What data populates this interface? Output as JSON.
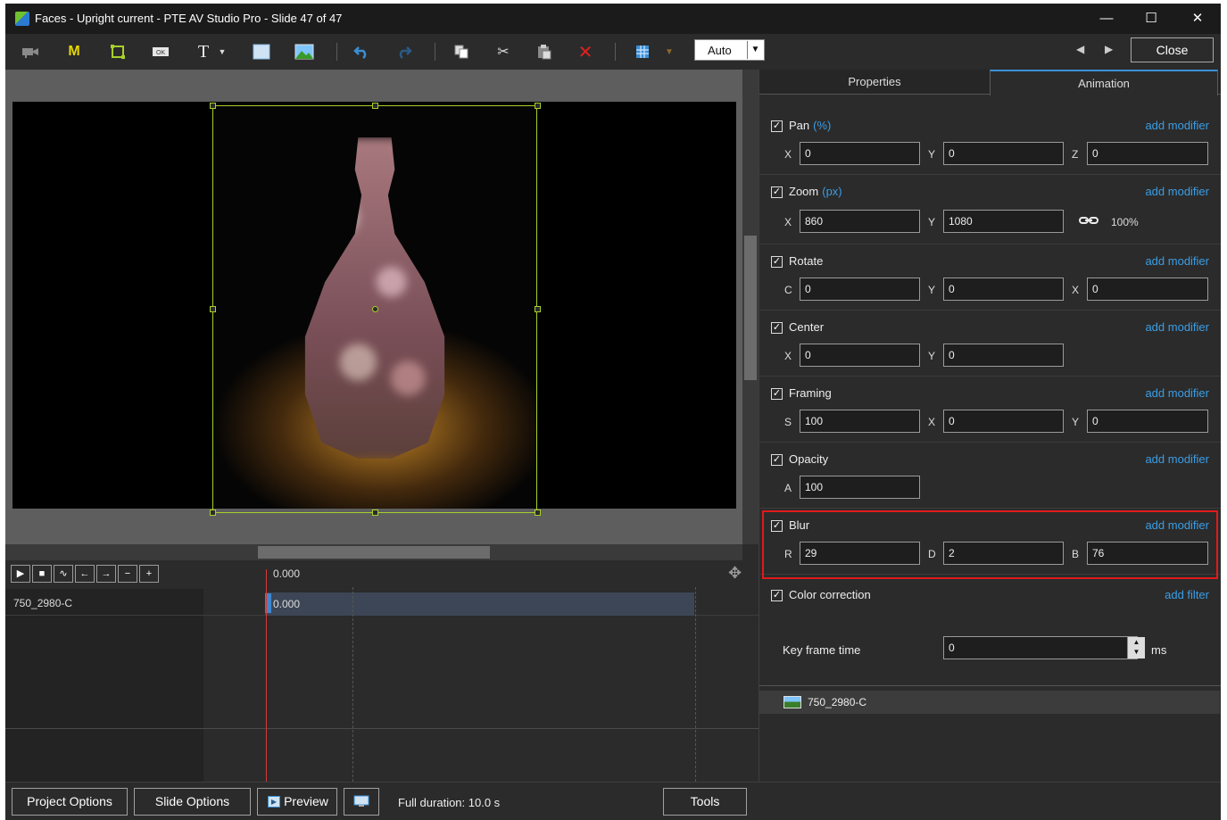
{
  "window": {
    "title": "Faces - Upright current - PTE AV Studio Pro - Slide 47 of 47",
    "minimize_glyph": "—",
    "maximize_glyph": "☐",
    "close_glyph": "✕"
  },
  "toolbar": {
    "main_menu_label": "M",
    "text_label": "T",
    "auto_label": "Auto",
    "close_label": "Close"
  },
  "timeline": {
    "ruler_time": "0.000",
    "track_name": "750_2980-C",
    "bar_time": "0.000"
  },
  "tabs": {
    "properties": "Properties",
    "animation": "Animation"
  },
  "sections": {
    "pan": {
      "title": "Pan",
      "unit": "(%)",
      "modifier": "add modifier",
      "fields": [
        {
          "label": "X",
          "value": "0"
        },
        {
          "label": "Y",
          "value": "0"
        },
        {
          "label": "Z",
          "value": "0"
        }
      ]
    },
    "zoom": {
      "title": "Zoom",
      "unit": "(px)",
      "modifier": "add modifier",
      "fields": [
        {
          "label": "X",
          "value": "860"
        },
        {
          "label": "Y",
          "value": "1080"
        }
      ],
      "percent": "100%"
    },
    "rotate": {
      "title": "Rotate",
      "modifier": "add modifier",
      "fields": [
        {
          "label": "C",
          "value": "0"
        },
        {
          "label": "Y",
          "value": "0"
        },
        {
          "label": "X",
          "value": "0"
        }
      ]
    },
    "center": {
      "title": "Center",
      "modifier": "add modifier",
      "fields": [
        {
          "label": "X",
          "value": "0"
        },
        {
          "label": "Y",
          "value": "0"
        }
      ]
    },
    "framing": {
      "title": "Framing",
      "modifier": "add modifier",
      "fields": [
        {
          "label": "S",
          "value": "100"
        },
        {
          "label": "X",
          "value": "0"
        },
        {
          "label": "Y",
          "value": "0"
        }
      ]
    },
    "opacity": {
      "title": "Opacity",
      "modifier": "add modifier",
      "fields": [
        {
          "label": "A",
          "value": "100"
        }
      ]
    },
    "blur": {
      "title": "Blur",
      "modifier": "add modifier",
      "fields": [
        {
          "label": "R",
          "value": "29"
        },
        {
          "label": "D",
          "value": "2"
        },
        {
          "label": "B",
          "value": "76"
        }
      ]
    },
    "color_correction": {
      "title": "Color correction",
      "modifier": "add filter"
    }
  },
  "keyframe": {
    "label": "Key frame time",
    "value": "0",
    "unit": "ms"
  },
  "object_list": {
    "item": "750_2980-C"
  },
  "bottom": {
    "project_options": "Project Options",
    "slide_options": "Slide Options",
    "preview": "Preview",
    "full_duration": "Full duration: 10.0 s",
    "tools": "Tools"
  },
  "colors": {
    "accent_blue": "#3a9ee6",
    "selection_green": "#a8d02a",
    "highlight_red": "#e01a1a",
    "playhead_red": "#d23a3a"
  }
}
